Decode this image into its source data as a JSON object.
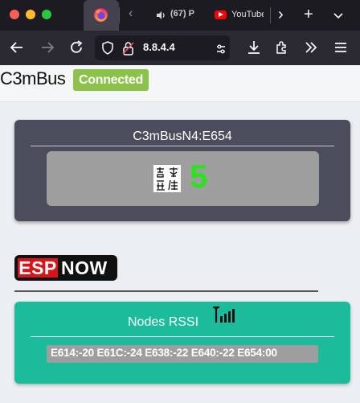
{
  "browser": {
    "tabs": [
      {
        "label": "(67) P",
        "audio": true
      },
      {
        "label": "YouTube"
      }
    ],
    "url": "8.8.4.4"
  },
  "page": {
    "brand": "C3mBus",
    "status": "Connected",
    "node_card": {
      "title": "C3mBusN4:E654",
      "value": "5",
      "value_color": "#27e51a"
    },
    "espnow": {
      "esp": "ESP",
      "now": "NOW"
    },
    "rssi_card": {
      "title": "Nodes RSSI",
      "readout": "E614:-20 E61C:-24 E638:-22 E640:-22 E654:00"
    }
  },
  "colors": {
    "card_dark": "#4b4c5c",
    "card_green": "#1abc9c",
    "badge": "#8bc34a",
    "espnow_red": "#d7141a"
  }
}
